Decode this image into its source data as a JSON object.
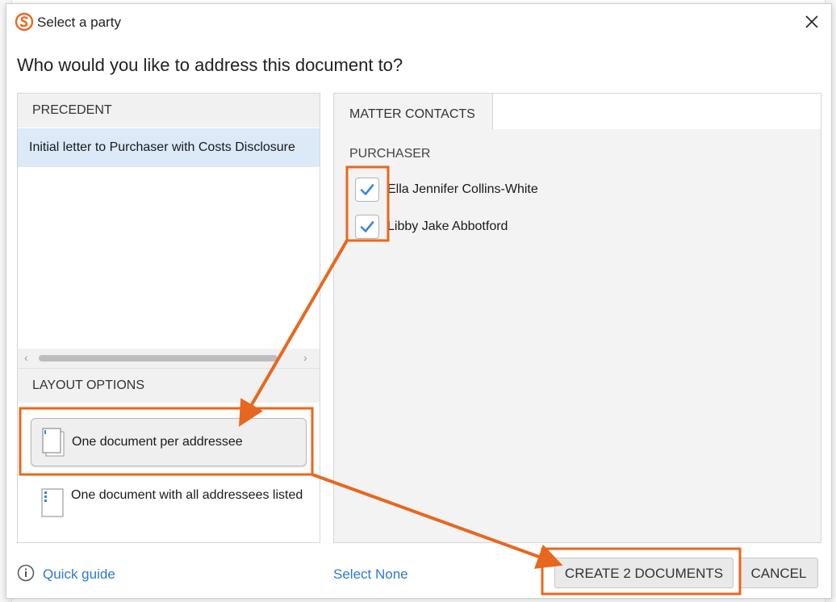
{
  "dialog": {
    "title": "Select a party",
    "question": "Who would you like to address this document to?"
  },
  "precedent": {
    "header": "PRECEDENT",
    "items": [
      "Initial letter to Purchaser with Costs Disclosure"
    ]
  },
  "layout_options": {
    "header": "LAYOUT OPTIONS",
    "options": [
      {
        "label": "One document per addressee",
        "selected": true
      },
      {
        "label": "One document with all addressees listed",
        "selected": false
      }
    ]
  },
  "contacts": {
    "tab_label": "MATTER CONTACTS",
    "group_label": "PURCHASER",
    "items": [
      {
        "name": "Ella Jennifer Collins-White",
        "checked": true
      },
      {
        "name": "Libby Jake Abbotford",
        "checked": true
      }
    ]
  },
  "footer": {
    "quick_guide": "Quick guide",
    "select_none": "Select None",
    "create_button": "CREATE 2 DOCUMENTS",
    "cancel_button": "CANCEL"
  },
  "colors": {
    "accent": "#2f78d0",
    "highlight": "#e8671e",
    "selected_row": "#dce9f7",
    "check": "#3a86e0"
  }
}
